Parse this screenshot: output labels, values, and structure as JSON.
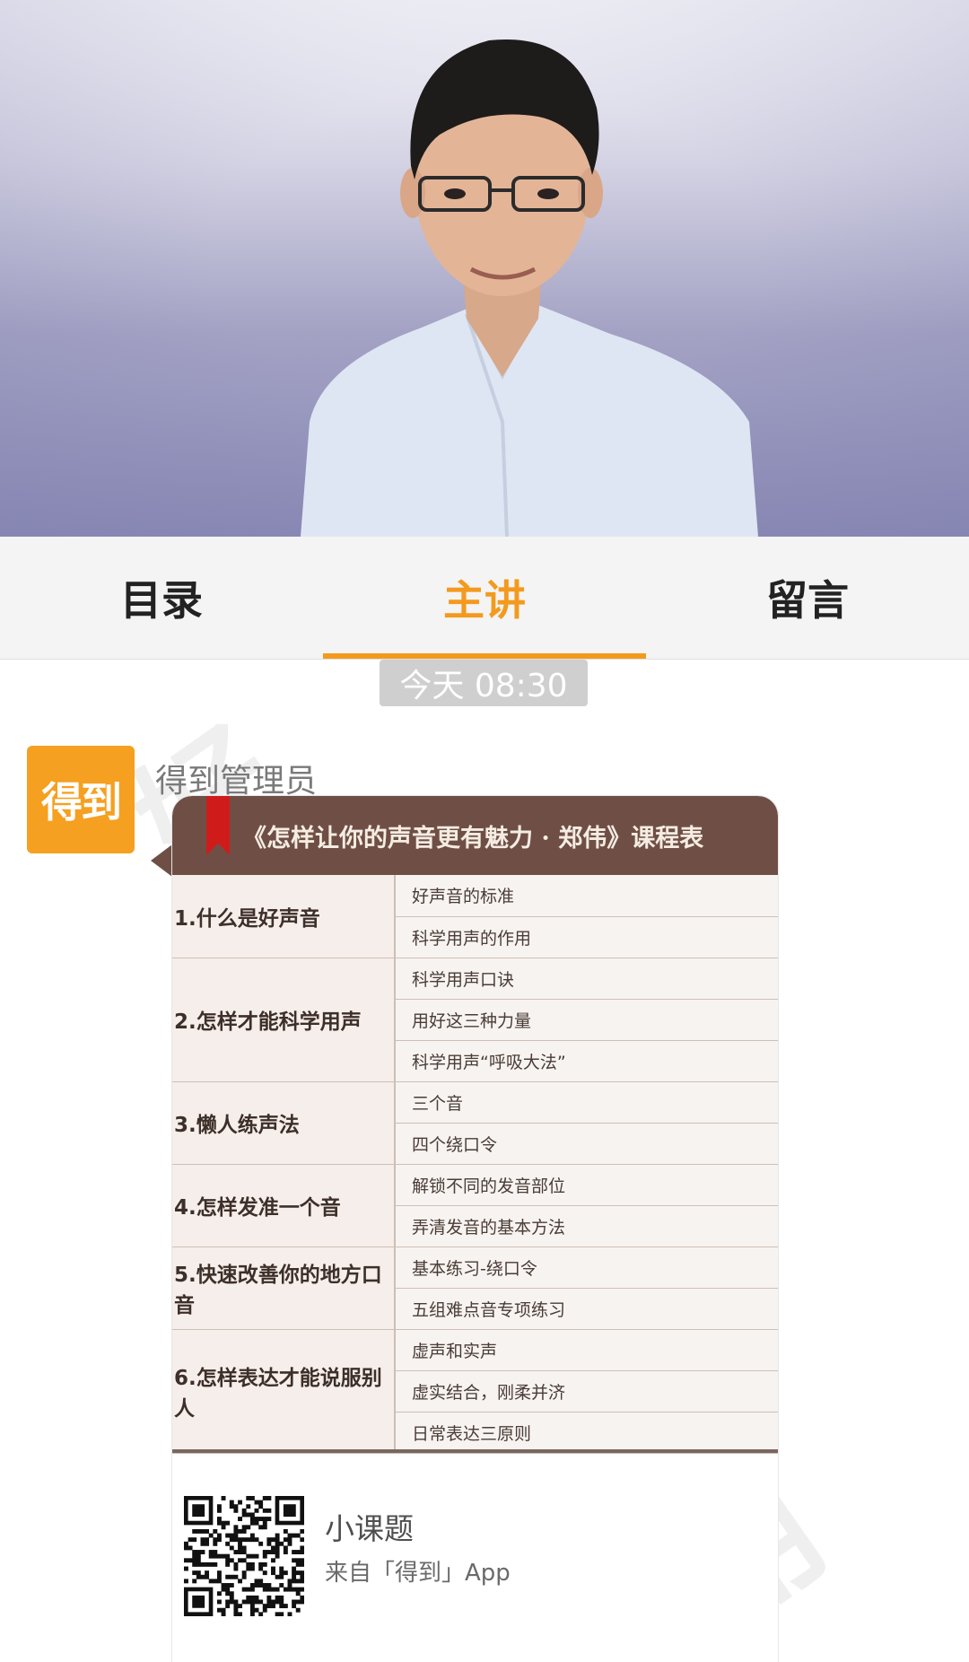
{
  "tabs": [
    {
      "label": "目录",
      "active": false
    },
    {
      "label": "主讲",
      "active": true
    },
    {
      "label": "留言",
      "active": false
    }
  ],
  "accent_color": "#f39a1e",
  "chat": {
    "timestamp": "今天 08:30",
    "avatar_text": "得到",
    "sender": "得到管理员",
    "card": {
      "title": "《怎样让你的声音更有魅力 · 郑伟》课程表",
      "chapters": [
        {
          "name": "1.什么是好声音",
          "lessons": [
            "好声音的标准",
            "科学用声的作用"
          ]
        },
        {
          "name": "2.怎样才能科学用声",
          "lessons": [
            "科学用声口诀",
            "用好这三种力量",
            "科学用声“呼吸大法”"
          ]
        },
        {
          "name": "3.懒人练声法",
          "lessons": [
            "三个音",
            "四个绕口令"
          ]
        },
        {
          "name": "4.怎样发准一个音",
          "lessons": [
            "解锁不同的发音部位",
            "弄清发音的基本方法"
          ]
        },
        {
          "name": "5.快速改善你的地方口音",
          "lessons": [
            "基本练习-绕口令",
            "五组难点音专项练习"
          ]
        },
        {
          "name": "6.怎样表达才能说服别人",
          "lessons": [
            "虚声和实声",
            "虚实结合，刚柔并济",
            "日常表达三原则"
          ]
        }
      ],
      "footer_title": "小课题",
      "footer_subtitle": "来自「得到」App"
    }
  }
}
